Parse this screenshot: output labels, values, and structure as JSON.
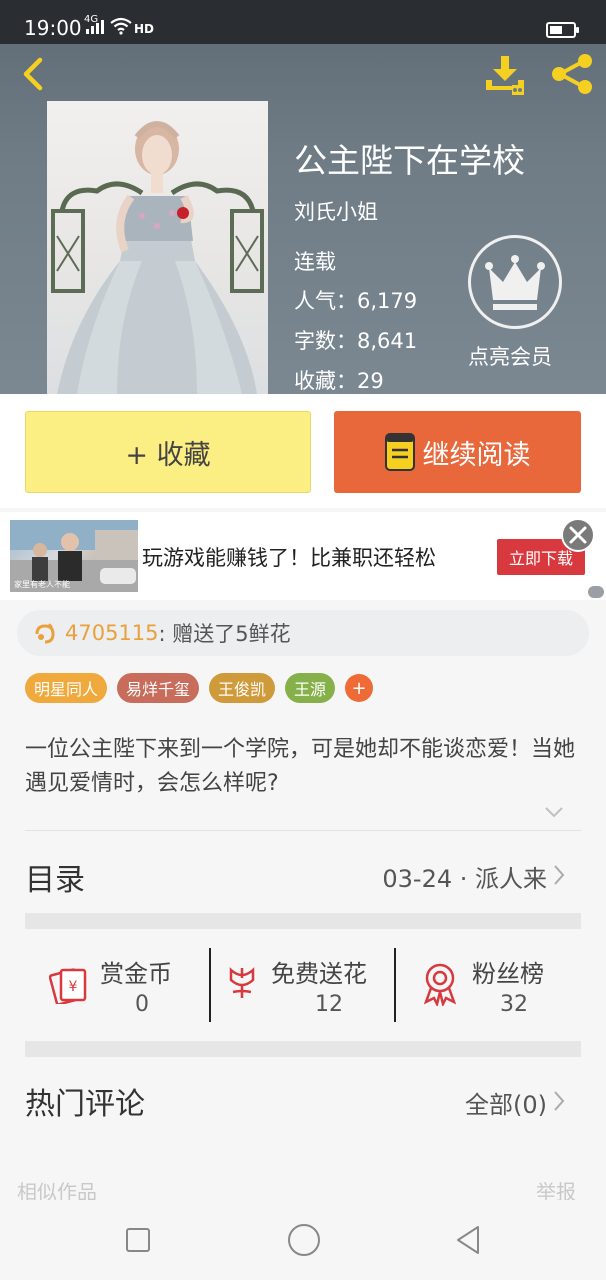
{
  "status_bar": {
    "time": "19:00",
    "network": "4G",
    "hd": "HD",
    "battery_level": 0.55
  },
  "header": {
    "back_icon": "chevron-left-icon",
    "download_icon": "download-icon",
    "share_icon": "share-icon"
  },
  "book": {
    "title": "公主陛下在学校",
    "author": "刘氏小姐",
    "status": "连载",
    "popularity": "人气：6,179",
    "word_count": "字数：8,641",
    "favorites": "收藏：29",
    "vip_label": "点亮会员"
  },
  "actions": {
    "favorite_label": "+ 收藏",
    "continue_label": "继续阅读"
  },
  "ad": {
    "image_caption": "家里有老人不能",
    "text": "玩游戏能赚钱了！比兼职还轻松",
    "button_label": "立即下载"
  },
  "gift": {
    "user": "4705115",
    "message": " : 赠送了5鲜花"
  },
  "tags": [
    {
      "label": "明星同人",
      "color": "#f0a93c"
    },
    {
      "label": "易烊千玺",
      "color": "#c86d5c"
    },
    {
      "label": "王俊凯",
      "color": "#cf9a3a"
    },
    {
      "label": "王源",
      "color": "#86b04a"
    }
  ],
  "tags_more": "+",
  "description": "一位公主陛下来到一个学院，可是她却不能谈恋爱！当她遇见爱情时，会怎么样呢?",
  "toc": {
    "title": "目录",
    "latest": "03-24 · 派人来"
  },
  "stats": [
    {
      "label": "赏金币",
      "value": "0",
      "icon": "red-envelope-icon"
    },
    {
      "label": "免费送花",
      "value": "12",
      "icon": "flower-icon"
    },
    {
      "label": "粉丝榜",
      "value": "32",
      "icon": "medal-icon"
    }
  ],
  "comments": {
    "title": "热门评论",
    "all_label": "全部(0)"
  },
  "footer": {
    "similar": "相似作品",
    "report": "举报"
  },
  "colors": {
    "favorite_button": "#fbee82",
    "continue_button": "#e9683b",
    "accent_red": "#d8393e",
    "icon_yellow": "#f5d020"
  }
}
